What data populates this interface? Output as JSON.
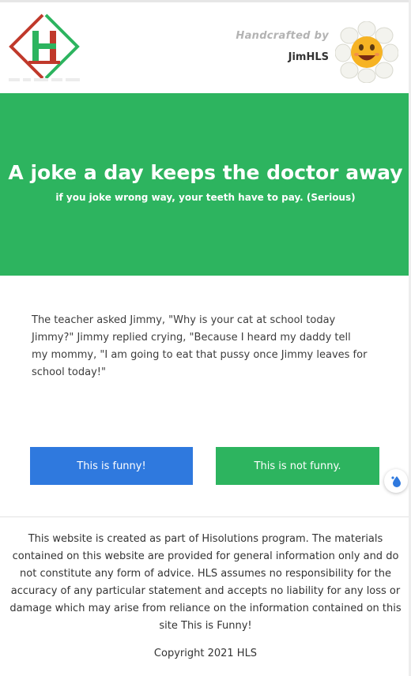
{
  "header": {
    "tagline": "Handcrafted by",
    "author": "JimHLS",
    "logo_icon": "hls-logo-icon",
    "avatar_icon": "smiling-flower-avatar"
  },
  "hero": {
    "title": "A joke a day keeps the doctor away",
    "subtitle": "if you joke wrong way, your teeth have to pay. (Serious)"
  },
  "joke": {
    "text": "The teacher asked Jimmy, \"Why is your cat at school today\nJimmy?\" Jimmy replied crying, \"Because I heard my daddy tell\nmy mommy, \"I am going to eat that pussy once Jimmy leaves for\nschool today!\""
  },
  "actions": {
    "funny_label": "This is funny!",
    "not_funny_label": "This is not funny."
  },
  "footer": {
    "disclaimer": "This website is created as part of Hisolutions program. The materials contained on this website are provided for general information only and do not constitute any form of advice. HLS assumes no responsibility for the accuracy of any particular statement and accepts no liability for any loss or damage which may arise from reliance on the information contained on this site This is Funny!",
    "copyright": "Copyright 2021 HLS"
  },
  "colors": {
    "green": "#2db45f",
    "blue": "#2f79de",
    "logo_red": "#c0392b"
  }
}
